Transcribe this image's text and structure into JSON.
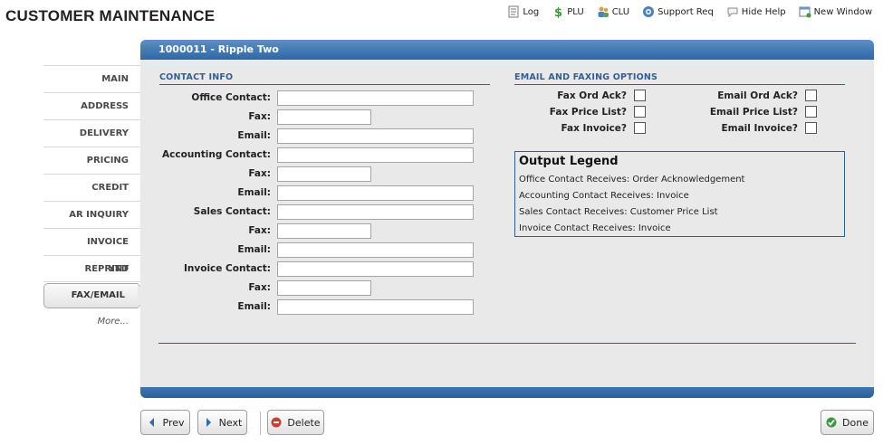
{
  "app": {
    "title": "CUSTOMER MAINTENANCE"
  },
  "toolbar": {
    "items": [
      {
        "label": "Log",
        "icon": "log-icon"
      },
      {
        "label": "PLU",
        "icon": "dollar-icon"
      },
      {
        "label": "CLU",
        "icon": "users-icon"
      },
      {
        "label": "Support Req",
        "icon": "support-icon"
      },
      {
        "label": "Hide Help",
        "icon": "help-bubble-icon"
      },
      {
        "label": "New Window",
        "icon": "new-window-icon"
      }
    ]
  },
  "sidebar": {
    "items": [
      {
        "label": "MAIN"
      },
      {
        "label": "ADDRESS"
      },
      {
        "label": "DELIVERY"
      },
      {
        "label": "PRICING"
      },
      {
        "label": "CREDIT"
      },
      {
        "label": "AR INQUIRY"
      },
      {
        "label": "INVOICE REPRINT"
      },
      {
        "label": "YTD"
      },
      {
        "label": "FAX/EMAIL",
        "active": true
      }
    ],
    "more_label": "More..."
  },
  "panel": {
    "header": "1000011 - Ripple Two"
  },
  "contact_info": {
    "title": "CONTACT INFO",
    "fields": [
      {
        "label": "Office Contact:",
        "value": "",
        "size": "long"
      },
      {
        "label": "Fax:",
        "value": "",
        "size": "short"
      },
      {
        "label": "Email:",
        "value": "",
        "size": "long"
      },
      {
        "label": "Accounting Contact:",
        "value": "",
        "size": "long"
      },
      {
        "label": "Fax:",
        "value": "",
        "size": "short"
      },
      {
        "label": "Email:",
        "value": "",
        "size": "long"
      },
      {
        "label": "Sales Contact:",
        "value": "",
        "size": "long"
      },
      {
        "label": "Fax:",
        "value": "",
        "size": "short"
      },
      {
        "label": "Email:",
        "value": "",
        "size": "long"
      },
      {
        "label": "Invoice Contact:",
        "value": "",
        "size": "long"
      },
      {
        "label": "Fax:",
        "value": "",
        "size": "short"
      },
      {
        "label": "Email:",
        "value": "",
        "size": "long"
      }
    ]
  },
  "email_fax_options": {
    "title": "EMAIL AND FAXING OPTIONS",
    "fax": [
      {
        "label": "Fax Ord Ack?",
        "checked": false
      },
      {
        "label": "Fax Price List?",
        "checked": false
      },
      {
        "label": "Fax Invoice?",
        "checked": false
      }
    ],
    "email": [
      {
        "label": "Email Ord Ack?",
        "checked": false
      },
      {
        "label": "Email Price List?",
        "checked": false
      },
      {
        "label": "Email Invoice?",
        "checked": false
      }
    ]
  },
  "legend": {
    "title": "Output Legend",
    "lines": [
      "Office Contact Receives: Order Acknowledgement",
      "Accounting Contact Receives: Invoice",
      "Sales Contact Receives: Customer Price List",
      "Invoice Contact Receives: Invoice"
    ]
  },
  "buttons": {
    "prev": "Prev",
    "next": "Next",
    "delete": "Delete",
    "done": "Done"
  },
  "colors": {
    "header_blue": "#2e68a5",
    "section_blue": "#2f5f98",
    "panel_bg": "#e9e9e9"
  }
}
